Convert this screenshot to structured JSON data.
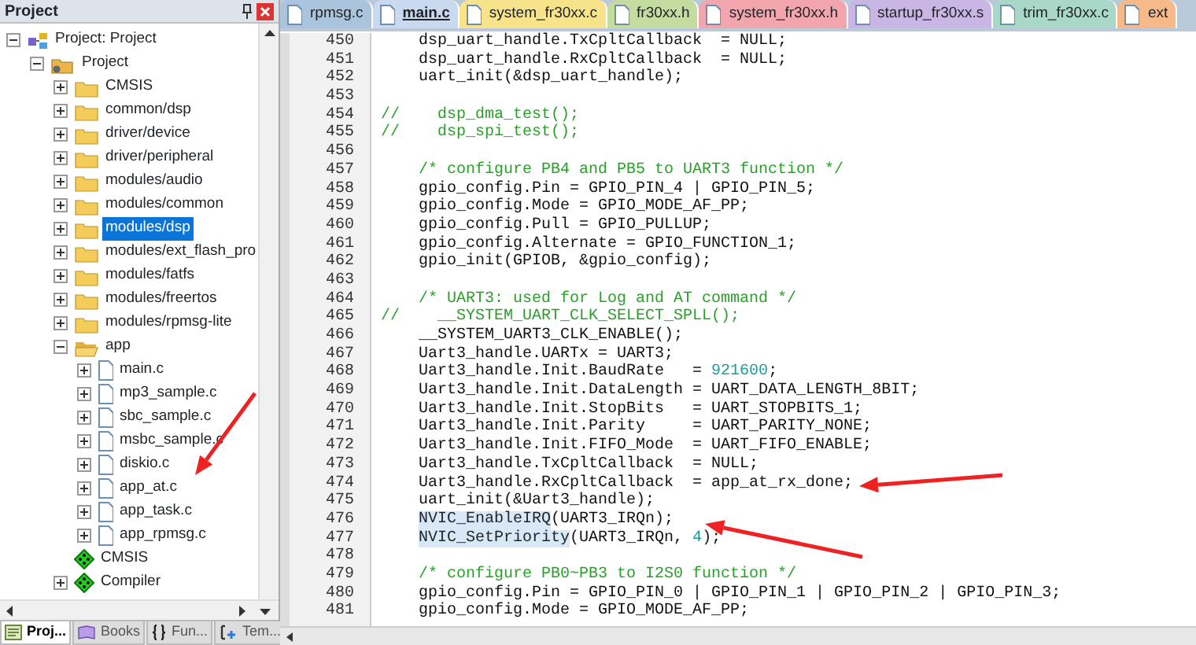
{
  "project_panel": {
    "title": "Project",
    "tree": [
      {
        "label": "Project: Project",
        "kind": "root",
        "expanded": true,
        "selected": false,
        "children": [
          {
            "label": "Project",
            "kind": "group",
            "expanded": true,
            "selected": false,
            "children": [
              {
                "label": "CMSIS",
                "kind": "folder",
                "expanded": false,
                "selected": false
              },
              {
                "label": "common/dsp",
                "kind": "folder",
                "expanded": false,
                "selected": false
              },
              {
                "label": "driver/device",
                "kind": "folder",
                "expanded": false,
                "selected": false
              },
              {
                "label": "driver/peripheral",
                "kind": "folder",
                "expanded": false,
                "selected": false
              },
              {
                "label": "modules/audio",
                "kind": "folder",
                "expanded": false,
                "selected": false
              },
              {
                "label": "modules/common",
                "kind": "folder",
                "expanded": false,
                "selected": false
              },
              {
                "label": "modules/dsp",
                "kind": "folder",
                "expanded": false,
                "selected": true
              },
              {
                "label": "modules/ext_flash_pro",
                "kind": "folder",
                "expanded": false,
                "selected": false
              },
              {
                "label": "modules/fatfs",
                "kind": "folder",
                "expanded": false,
                "selected": false
              },
              {
                "label": "modules/freertos",
                "kind": "folder",
                "expanded": false,
                "selected": false
              },
              {
                "label": "modules/rpmsg-lite",
                "kind": "folder",
                "expanded": false,
                "selected": false
              },
              {
                "label": "app",
                "kind": "folder",
                "expanded": true,
                "selected": false,
                "children": [
                  {
                    "label": "main.c",
                    "kind": "file",
                    "expanded": false,
                    "selected": false
                  },
                  {
                    "label": "mp3_sample.c",
                    "kind": "file",
                    "expanded": false,
                    "selected": false
                  },
                  {
                    "label": "sbc_sample.c",
                    "kind": "file",
                    "expanded": false,
                    "selected": false
                  },
                  {
                    "label": "msbc_sample.c",
                    "kind": "file",
                    "expanded": false,
                    "selected": false
                  },
                  {
                    "label": "diskio.c",
                    "kind": "file",
                    "expanded": false,
                    "selected": false
                  },
                  {
                    "label": "app_at.c",
                    "kind": "file",
                    "expanded": false,
                    "selected": false
                  },
                  {
                    "label": "app_task.c",
                    "kind": "file",
                    "expanded": false,
                    "selected": false
                  },
                  {
                    "label": "app_rpmsg.c",
                    "kind": "file",
                    "expanded": false,
                    "selected": false
                  }
                ]
              },
              {
                "label": "CMSIS",
                "kind": "component",
                "selected": false
              },
              {
                "label": "Compiler",
                "kind": "component",
                "expanded": false,
                "selected": false
              }
            ]
          }
        ]
      }
    ],
    "tabs": [
      {
        "label": "Proj...",
        "kind": "project",
        "selected": true
      },
      {
        "label": "Books",
        "kind": "books",
        "selected": false
      },
      {
        "label": "Fun...",
        "kind": "functions",
        "selected": false
      },
      {
        "label": "Tem...",
        "kind": "templates",
        "selected": false
      }
    ]
  },
  "editor": {
    "tabs": [
      {
        "label": "rpmsg.c",
        "color": "#a9c4dc",
        "selected": false
      },
      {
        "label": "main.c",
        "color": "#c9d9f0",
        "selected": true
      },
      {
        "label": "system_fr30xx.c",
        "color": "#f7e38a",
        "selected": false
      },
      {
        "label": "fr30xx.h",
        "color": "#c5dca0",
        "selected": false
      },
      {
        "label": "system_fr30xx.h",
        "color": "#f3a5ad",
        "selected": false
      },
      {
        "label": "startup_fr30xx.s",
        "color": "#c9b6e4",
        "selected": false
      },
      {
        "label": "trim_fr30xx.c",
        "color": "#a9d8c8",
        "selected": false
      },
      {
        "label": "ext",
        "color": "#f5b98a",
        "selected": false
      }
    ],
    "lines": [
      {
        "number": "450",
        "segments": [
          {
            "kind": "code",
            "text": "    dsp_uart_handle.TxCpltCallback  = NULL;"
          }
        ]
      },
      {
        "number": "451",
        "segments": [
          {
            "kind": "code",
            "text": "    dsp_uart_handle.RxCpltCallback  = NULL;"
          }
        ]
      },
      {
        "number": "452",
        "segments": [
          {
            "kind": "code",
            "text": "    uart_init(&dsp_uart_handle);"
          }
        ]
      },
      {
        "number": "453"
      },
      {
        "number": "454",
        "segments": [
          {
            "kind": "comment",
            "text": "//    dsp_dma_test();"
          }
        ]
      },
      {
        "number": "455",
        "segments": [
          {
            "kind": "comment",
            "text": "//    dsp_spi_test();"
          }
        ]
      },
      {
        "number": "456"
      },
      {
        "number": "457",
        "segments": [
          {
            "kind": "comment",
            "text": "    /* configure PB4 and PB5 to UART3 function */"
          }
        ]
      },
      {
        "number": "458",
        "segments": [
          {
            "kind": "code",
            "text": "    gpio_config.Pin = GPIO_PIN_4 | GPIO_PIN_5;"
          }
        ]
      },
      {
        "number": "459",
        "segments": [
          {
            "kind": "code",
            "text": "    gpio_config.Mode = GPIO_MODE_AF_PP;"
          }
        ]
      },
      {
        "number": "460",
        "segments": [
          {
            "kind": "code",
            "text": "    gpio_config.Pull = GPIO_PULLUP;"
          }
        ]
      },
      {
        "number": "461",
        "segments": [
          {
            "kind": "code",
            "text": "    gpio_config.Alternate = GPIO_FUNCTION_1;"
          }
        ]
      },
      {
        "number": "462",
        "segments": [
          {
            "kind": "code",
            "text": "    gpio_init(GPIOB, &gpio_config);"
          }
        ]
      },
      {
        "number": "463"
      },
      {
        "number": "464",
        "segments": [
          {
            "kind": "comment",
            "text": "    /* UART3: used for Log and AT command */"
          }
        ]
      },
      {
        "number": "465",
        "segments": [
          {
            "kind": "comment",
            "text": "//    __SYSTEM_UART_CLK_SELECT_SPLL();"
          }
        ]
      },
      {
        "number": "466",
        "segments": [
          {
            "kind": "code",
            "text": "    __SYSTEM_UART3_CLK_ENABLE();"
          }
        ]
      },
      {
        "number": "467",
        "segments": [
          {
            "kind": "code",
            "text": "    Uart3_handle.UARTx = UART3;"
          }
        ]
      },
      {
        "number": "468",
        "segments": [
          {
            "kind": "code",
            "text": "    Uart3_handle.Init.BaudRate   = "
          },
          {
            "kind": "number",
            "text": "921600"
          },
          {
            "kind": "code",
            "text": ";"
          }
        ]
      },
      {
        "number": "469",
        "segments": [
          {
            "kind": "code",
            "text": "    Uart3_handle.Init.DataLength = UART_DATA_LENGTH_8BIT;"
          }
        ]
      },
      {
        "number": "470",
        "segments": [
          {
            "kind": "code",
            "text": "    Uart3_handle.Init.StopBits   = UART_STOPBITS_1;"
          }
        ]
      },
      {
        "number": "471",
        "segments": [
          {
            "kind": "code",
            "text": "    Uart3_handle.Init.Parity     = UART_PARITY_NONE;"
          }
        ]
      },
      {
        "number": "472",
        "segments": [
          {
            "kind": "code",
            "text": "    Uart3_handle.Init.FIFO_Mode  = UART_FIFO_ENABLE;"
          }
        ]
      },
      {
        "number": "473",
        "segments": [
          {
            "kind": "code",
            "text": "    Uart3_handle.TxCpltCallback  = NULL;"
          }
        ]
      },
      {
        "number": "474",
        "segments": [
          {
            "kind": "code",
            "text": "    Uart3_handle.RxCpltCallback  = app_at_rx_done;"
          }
        ]
      },
      {
        "number": "475",
        "segments": [
          {
            "kind": "code",
            "text": "    uart_init(&Uart3_handle);"
          }
        ]
      },
      {
        "number": "476",
        "segments": [
          {
            "kind": "highlight",
            "text": "    NVIC_EnableIRQ"
          },
          {
            "kind": "code",
            "text": "(UART3_IRQn);"
          }
        ]
      },
      {
        "number": "477",
        "segments": [
          {
            "kind": "highlight",
            "text": "    NVIC_SetPriority"
          },
          {
            "kind": "code",
            "text": "(UART3_IRQn, "
          },
          {
            "kind": "number",
            "text": "4"
          },
          {
            "kind": "code",
            "text": ");"
          }
        ]
      },
      {
        "number": "478"
      },
      {
        "number": "479",
        "segments": [
          {
            "kind": "comment",
            "text": "    /* configure PB0~PB3 to I2S0 function */"
          }
        ]
      },
      {
        "number": "480",
        "segments": [
          {
            "kind": "code",
            "text": "    gpio_config.Pin = GPIO_PIN_0 | GPIO_PIN_1 | GPIO_PIN_2 | GPIO_PIN_3;"
          }
        ]
      },
      {
        "number": "481",
        "segments": [
          {
            "kind": "code",
            "text": "    gpio_config.Mode = GPIO_MODE_AF_PP;"
          }
        ]
      }
    ]
  }
}
